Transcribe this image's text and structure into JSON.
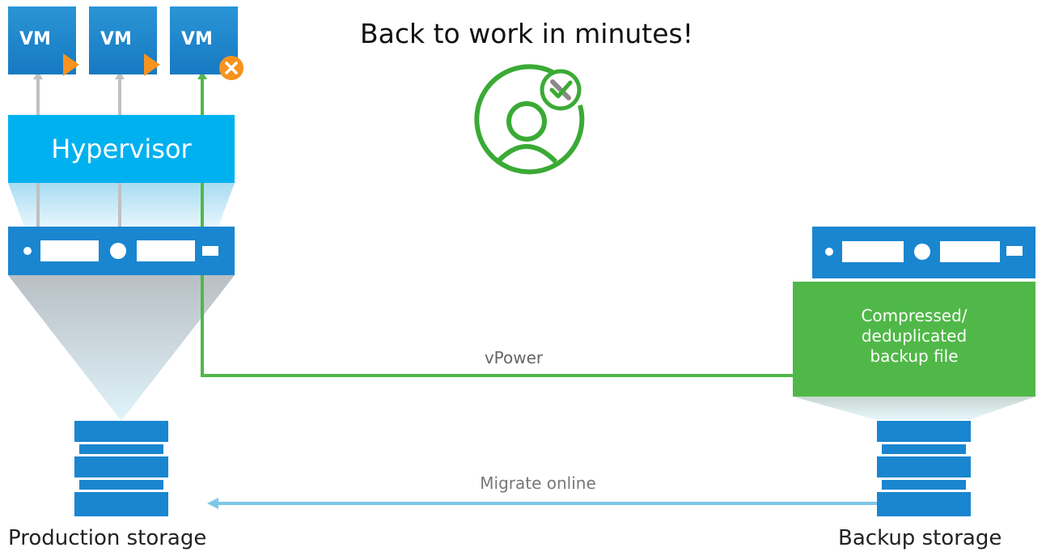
{
  "title": "Back to work in minutes!",
  "vms": [
    {
      "label": "VM",
      "status": "running"
    },
    {
      "label": "VM",
      "status": "running"
    },
    {
      "label": "VM",
      "status": "failed"
    }
  ],
  "hypervisor": {
    "label": "Hypervisor"
  },
  "connections": {
    "vpower_label": "vPower",
    "migrate_label": "Migrate online"
  },
  "backup_file": {
    "lines": [
      "Compressed/",
      "deduplicated",
      "backup file"
    ]
  },
  "storage": {
    "production_label": "Production storage",
    "backup_label": "Backup storage"
  },
  "icons": {
    "user": "user-restore-icon",
    "server": "server-icon",
    "storage": "storage-stack-icon"
  },
  "colors": {
    "blue": "#00b1ef",
    "dark_blue": "#1a86d0",
    "green": "#50b848",
    "orange": "#f7931e",
    "light_blue": "#7cc6ea",
    "gray": "#c0c0c0"
  }
}
